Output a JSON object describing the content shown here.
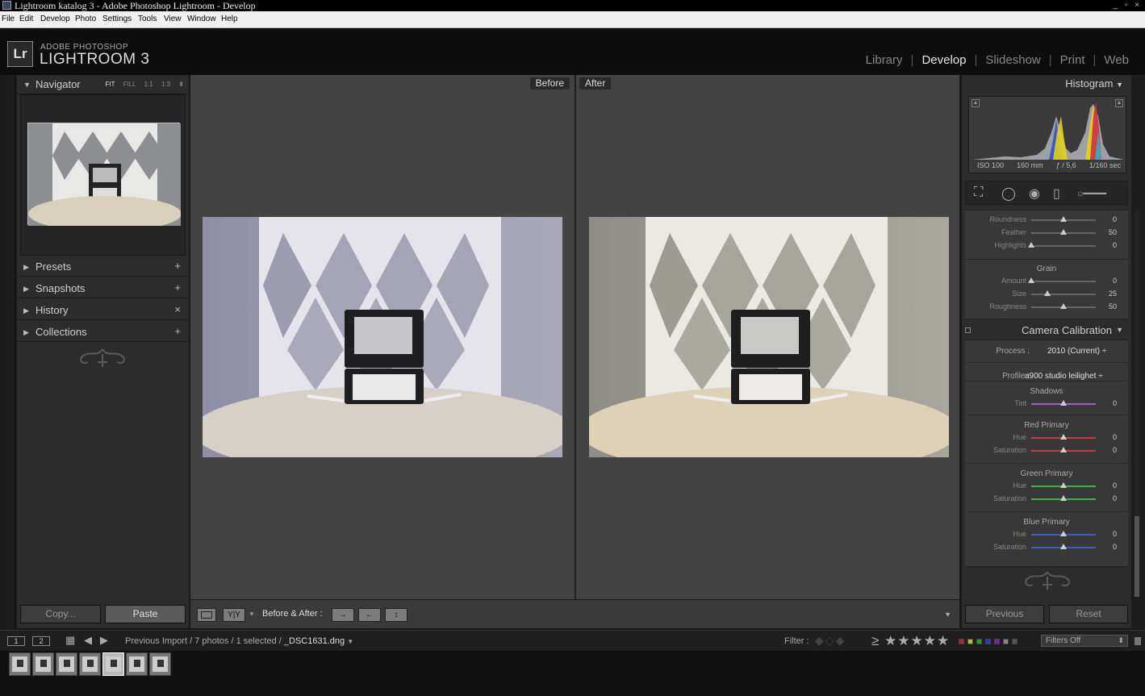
{
  "window": {
    "title": "Lightroom katalog 3 - Adobe Photoshop Lightroom - Develop",
    "controls": "_ ▫ ×"
  },
  "menu": [
    "File",
    "Edit",
    "Develop",
    "Photo",
    "Settings",
    "Tools",
    "View",
    "Window",
    "Help"
  ],
  "brand": {
    "icon": "Lr",
    "small": "ADOBE PHOTOSHOP",
    "big": "LIGHTROOM 3"
  },
  "modules": [
    "Library",
    "Develop",
    "Slideshow",
    "Print",
    "Web"
  ],
  "active_module": "Develop",
  "left_panel": {
    "navigator": {
      "label": "Navigator",
      "options": [
        "FIT",
        "FILL",
        "1:1",
        "1:3"
      ],
      "selected_option": "FIT"
    },
    "sections": [
      {
        "label": "Presets",
        "action": "+"
      },
      {
        "label": "Snapshots",
        "action": "+"
      },
      {
        "label": "History",
        "action": "×"
      },
      {
        "label": "Collections",
        "action": "+"
      }
    ],
    "copy_label": "Copy...",
    "paste_label": "Paste"
  },
  "center": {
    "before_label": "Before",
    "after_label": "After"
  },
  "toolbar": {
    "view_yy": "Y|Y",
    "before_after_label": "Before & After :",
    "swap_icons": [
      "→",
      "←",
      "↕"
    ]
  },
  "right_panel": {
    "histogram": {
      "label": "Histogram",
      "iso": "ISO 100",
      "focal": "160 mm",
      "aperture": "ƒ / 5,6",
      "shutter": "1/160 sec"
    },
    "effects_vignette": [
      {
        "label": "Roundness",
        "value": "0",
        "pos": 0.5
      },
      {
        "label": "Feather",
        "value": "50",
        "pos": 0.5
      },
      {
        "label": "Highlights",
        "value": "0",
        "pos": 0.0
      }
    ],
    "grain": {
      "title": "Grain",
      "rows": [
        {
          "label": "Amount",
          "value": "0",
          "pos": 0.0
        },
        {
          "label": "Size",
          "value": "25",
          "pos": 0.25
        },
        {
          "label": "Roughness",
          "value": "50",
          "pos": 0.5
        }
      ]
    },
    "camera_calibration": {
      "label": "Camera Calibration",
      "process_label": "Process :",
      "process_value": "2010 (Current) ÷",
      "profile_label": "Profile :",
      "profile_value": "a900 studio leilighet ÷",
      "groups": [
        {
          "title": "Shadows",
          "rows": [
            {
              "label": "Tint",
              "value": "0",
              "pos": 0.5,
              "color": "#a060c0"
            }
          ]
        },
        {
          "title": "Red Primary",
          "rows": [
            {
              "label": "Hue",
              "value": "0",
              "pos": 0.5,
              "color": "#c04040"
            },
            {
              "label": "Saturation",
              "value": "0",
              "pos": 0.5,
              "color": "#c04040"
            }
          ]
        },
        {
          "title": "Green Primary",
          "rows": [
            {
              "label": "Hue",
              "value": "0",
              "pos": 0.5,
              "color": "#40b050"
            },
            {
              "label": "Saturation",
              "value": "0",
              "pos": 0.5,
              "color": "#40b050"
            }
          ]
        },
        {
          "title": "Blue Primary",
          "rows": [
            {
              "label": "Hue",
              "value": "0",
              "pos": 0.5,
              "color": "#4060c0"
            },
            {
              "label": "Saturation",
              "value": "0",
              "pos": 0.5,
              "color": "#4060c0"
            }
          ]
        }
      ]
    },
    "previous_label": "Previous",
    "reset_label": "Reset"
  },
  "filmstrip_bar": {
    "monitor1": "1",
    "monitor2": "2",
    "path": "Previous Import / 7 photos / 1 selected /",
    "filename": "_DSC1631.dng",
    "filter_label": "Filter :",
    "stars": "≥ ★★★★★",
    "filters_value": "Filters Off",
    "color_labels": [
      "#c02020",
      "#c0c020",
      "#20a020",
      "#2040c0",
      "#8020a0",
      "#888888",
      "#555555"
    ]
  },
  "filmstrip": {
    "count": 7,
    "selected_index": 4
  }
}
